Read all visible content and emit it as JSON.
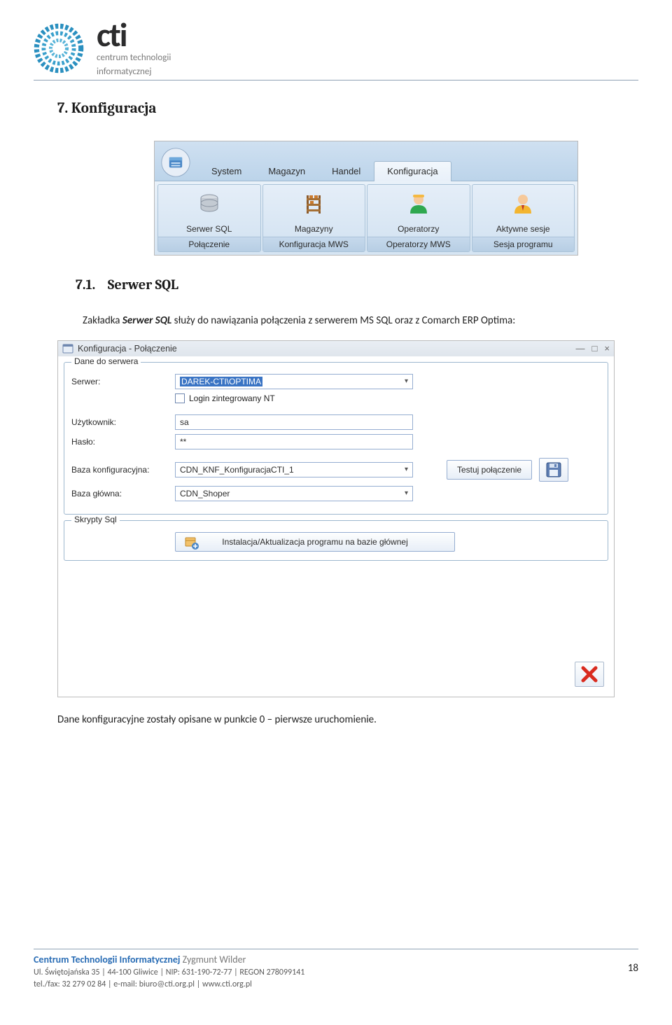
{
  "logo": {
    "brand": "cti",
    "subtitle_line1": "centrum technologii",
    "subtitle_line2": "informatycznej"
  },
  "section": {
    "number": "7.",
    "title": "Konfiguracja"
  },
  "subsection": {
    "number": "7.1.",
    "title": "Serwer SQL"
  },
  "body": {
    "para1_pre": "Zakładka ",
    "para1_bold": "Serwer SQL",
    "para1_post": " służy do nawiązania połączenia z serwerem MS SQL oraz z Comarch ERP Optima:",
    "para2": "Dane konfiguracyjne zostały opisane w punkcie 0 – pierwsze uruchomienie."
  },
  "ribbon": {
    "tabs": [
      {
        "label": "System"
      },
      {
        "label": "Magazyn"
      },
      {
        "label": "Handel"
      },
      {
        "label": "Konfiguracja",
        "active": true
      }
    ],
    "groups": [
      {
        "icon": "db",
        "label": "Serwer SQL",
        "footer": "Połączenie"
      },
      {
        "icon": "shelf",
        "label": "Magazyny",
        "footer": "Konfiguracja MWS"
      },
      {
        "icon": "person-green",
        "label": "Operatorzy",
        "footer": "Operatorzy MWS"
      },
      {
        "icon": "person-yellow",
        "label": "Aktywne sesje",
        "footer": "Sesja programu"
      }
    ]
  },
  "dialog": {
    "title": "Konfiguracja - Połączenie",
    "fieldset1_legend": "Dane do serwera",
    "labels": {
      "serwer": "Serwer:",
      "login_nt": "Login zintegrowany NT",
      "uzytkownik": "Użytkownik:",
      "haslo": "Hasło:",
      "baza_konf": "Baza konfiguracyjna:",
      "baza_glowna": "Baza główna:"
    },
    "values": {
      "serwer": "DAREK-CTI\\OPTIMA",
      "uzytkownik": "sa",
      "haslo": "**",
      "baza_konf": "CDN_KNF_KonfiguracjaCTI_1",
      "baza_glowna": "CDN_Shoper"
    },
    "buttons": {
      "testuj": "Testuj połączenie",
      "install": "Instalacja/Aktualizacja programu na bazie głównej"
    },
    "fieldset2_legend": "Skrypty Sql"
  },
  "footer": {
    "title_strong": "Centrum Technologii Informatycznej",
    "title_light": " Zygmunt Wilder",
    "line1": "Ul. Świętojańska 35  |  44-100 Gliwice  |  NIP: 631-190-72-77  |  REGON 278099141",
    "line2": "tel./fax: 32 279 02 84  |  e-mail: biuro@cti.org.pl  |  www.cti.org.pl",
    "page_number": "18"
  }
}
